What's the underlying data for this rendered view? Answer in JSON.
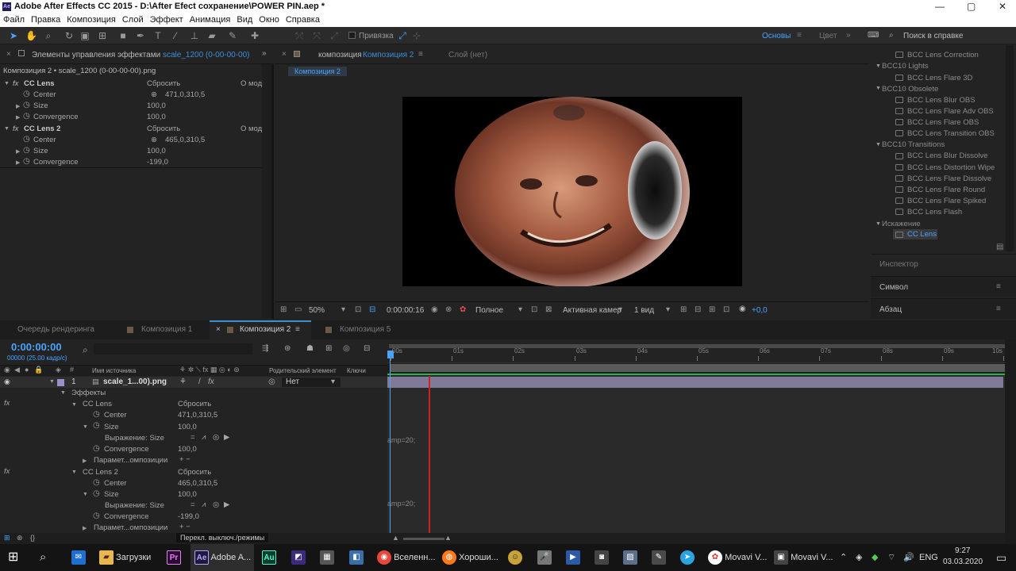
{
  "window": {
    "title": "Adobe After Effects CC 2015 - D:\\After Efect сохранение\\POWER PIN.aep *",
    "logo": "Ae"
  },
  "menu": [
    "Файл",
    "Правка",
    "Композиция",
    "Слой",
    "Эффект",
    "Анимация",
    "Вид",
    "Окно",
    "Справка"
  ],
  "toolbar": {
    "snap_label": "Привязка",
    "workspace": "Основы",
    "color_label": "Цвет",
    "help_search": "Поиск в справке"
  },
  "effects_panel": {
    "title": "Элементы управления эффектами",
    "layer_ref": "scale_1200 (0-00-00-00)",
    "breadcrumb": "Композиция 2 • scale_1200 (0-00-00-00).png",
    "effects": [
      {
        "name": "CC Lens",
        "reset": "Сбросить",
        "about": "О мод",
        "props": [
          {
            "name": "Center",
            "value": "471,0,310,5"
          },
          {
            "name": "Size",
            "value": "100,0"
          },
          {
            "name": "Convergence",
            "value": "100,0"
          }
        ]
      },
      {
        "name": "CC Lens 2",
        "reset": "Сбросить",
        "about": "О мод",
        "props": [
          {
            "name": "Center",
            "value": "465,0,310,5"
          },
          {
            "name": "Size",
            "value": "100,0"
          },
          {
            "name": "Convergence",
            "value": "-199,0"
          }
        ]
      }
    ]
  },
  "comp_panel": {
    "label": "композиция",
    "comp_name": "Композиция 2",
    "layer_tab": "Слой (нет)",
    "sub_tab": "Композиция 2",
    "footer": {
      "zoom": "50%",
      "timecode": "0:00:00:16",
      "quality": "Полное",
      "camera": "Активная камер",
      "views": "1 вид",
      "exposure": "+0,0"
    }
  },
  "effects_list": {
    "cut_top": "BCC Lens Correction",
    "groups": [
      {
        "name": "BCC10 Lights",
        "items": [
          "BCC Lens Flare 3D"
        ]
      },
      {
        "name": "BCC10 Obsolete",
        "items": [
          "BCC Lens Blur OBS",
          "BCC Lens Flare Adv OBS",
          "BCC Lens Flare OBS",
          "BCC Lens Transition OBS"
        ]
      },
      {
        "name": "BCC10 Transitions",
        "items": [
          "BCC Lens Blur Dissolve",
          "BCC Lens Distortion Wipe",
          "BCC Lens Flare Dissolve",
          "BCC Lens Flare Round",
          "BCC Lens Flare Spiked",
          "BCC Lens Flash"
        ]
      },
      {
        "name": "Искажение",
        "items": [
          "CC Lens"
        ]
      }
    ],
    "panels": [
      "Инспектор",
      "Символ",
      "Абзац"
    ]
  },
  "timeline_tabs": [
    "Очередь рендеринга",
    "Композиция 1",
    "Композиция 2",
    "Композиция 5"
  ],
  "timeline": {
    "timecode": "0:00:00:00",
    "fps": "00000 (25.00 кадр/с)",
    "col_source": "Имя источника",
    "col_parent": "Родительский элемент",
    "col_keys": "Ключи",
    "layer": {
      "num": "1",
      "name": "scale_1...00).png",
      "parent": "Нет"
    },
    "effects_group": "Эффекты",
    "lens1": {
      "name": "CC Lens",
      "reset": "Сбросить",
      "center": "471,0,310,5",
      "size": "100,0",
      "expr": "Выражение: Size",
      "conv": "100,0",
      "params": "Парамет...омпозиции"
    },
    "lens2": {
      "name": "CC Lens 2",
      "reset": "Сбросить",
      "center": "465,0,310,5",
      "size": "100,0",
      "expr": "Выражение: Size",
      "conv": "-199,0",
      "params": "Парамет...омпозиции"
    },
    "prop_center": "Center",
    "prop_size": "Size",
    "prop_conv": "Convergence",
    "expr_text": "amp=20;",
    "ruler": [
      "00s",
      "01s",
      "02s",
      "03s",
      "04s",
      "05s",
      "06s",
      "07s",
      "08s",
      "09s",
      "10s"
    ],
    "footer": "Перекл. выключ./режимы"
  },
  "taskbar": {
    "items": [
      "Загрузки",
      "Adobe A...",
      "Вселенн...",
      "Хороши...",
      "Movavi V...",
      "Movavi V..."
    ],
    "lang": "ENG",
    "time": "9:27",
    "date": "03.03.2020"
  }
}
